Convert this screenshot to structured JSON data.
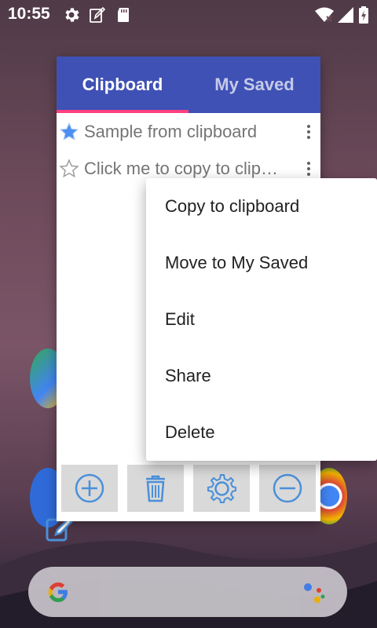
{
  "status_bar": {
    "time": "10:55",
    "icons": [
      "gear-icon",
      "edit-note-icon",
      "sd-card-icon",
      "wifi-icon",
      "cell-signal-icon",
      "battery-charging-icon"
    ]
  },
  "dialog": {
    "tabs": [
      {
        "label": "Clipboard",
        "active": true
      },
      {
        "label": "My Saved",
        "active": false
      }
    ],
    "items": [
      {
        "text": "Sample from clipboard",
        "starred": true
      },
      {
        "text": "Click me to copy to clipboard",
        "starred": false
      }
    ],
    "toolbar": [
      "add-icon",
      "trash-icon",
      "settings-icon",
      "remove-icon"
    ]
  },
  "context_menu": {
    "items": [
      "Copy to clipboard",
      "Move to My Saved",
      "Edit",
      "Share",
      "Delete"
    ]
  },
  "colors": {
    "tab_bar": "#3f51b5",
    "tab_indicator": "#ff4081",
    "star_active": "#4c8ff0",
    "icon_blue": "#4a90d9"
  }
}
